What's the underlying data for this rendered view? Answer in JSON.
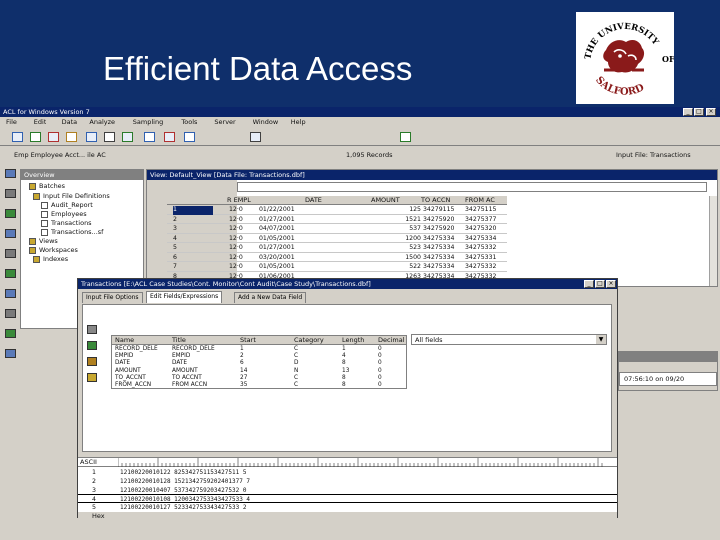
{
  "slide": {
    "title": "Efficient Data Access",
    "logo": {
      "top_text": "THE UNIVERSITY",
      "side_text": "OF",
      "bottom_text": "SALFORD",
      "emblem": "lion-crest-icon"
    }
  },
  "colors": {
    "header_band": "#0f2f6b",
    "title_bar": "#0a246a",
    "window_bg": "#d4d0c8",
    "logo_red": "#8a1a1a"
  },
  "app": {
    "title": "ACL for Windows Version 7",
    "menu": [
      "File",
      "Edit",
      "Data",
      "Analyze",
      "Sampling",
      "Tools",
      "Server",
      "Window",
      "Help"
    ],
    "status_left": "Emp Employee Acct... ile AC",
    "status_mid": "1,095 Records",
    "status_right": "Input File: Transactions",
    "time_display": "07:56:10 on 09/20",
    "toolbar_icons": [
      "open-icon",
      "save-icon",
      "print-icon",
      "cut-icon",
      "copy-icon",
      "paste-icon",
      "table-icon",
      "chart-icon",
      "filter-icon",
      "sort-icon",
      "find-icon",
      "help-icon"
    ]
  },
  "overview": {
    "title": "Overview",
    "items": [
      {
        "label": "Batches",
        "icon": "folder-icon"
      },
      {
        "label": "Input File Definitions",
        "icon": "folder-icon"
      },
      {
        "label": "Audit_Report",
        "icon": "file-icon"
      },
      {
        "label": "Employees",
        "icon": "file-icon"
      },
      {
        "label": "Transactions",
        "icon": "file-icon"
      },
      {
        "label": "Transactions...sf",
        "icon": "file-icon"
      },
      {
        "label": "Views",
        "icon": "folder-icon"
      },
      {
        "label": "Workspaces",
        "icon": "folder-icon"
      },
      {
        "label": "Indexes",
        "icon": "folder-icon"
      }
    ]
  },
  "view": {
    "title": "View: Default_View  [Data File: Transactions.dbf]",
    "columns": [
      "R EMPL",
      "DATE",
      "AMOUNT",
      "TO ACCN",
      "FROM AC"
    ],
    "rows": [
      {
        "n": "1",
        "empl": "12·0",
        "date": "01/22/2001",
        "amount": "125",
        "to": "34279115",
        "from": "34275115"
      },
      {
        "n": "2",
        "empl": "12·0",
        "date": "01/27/2001",
        "amount": "1521",
        "to": "34275920",
        "from": "34275377"
      },
      {
        "n": "3",
        "empl": "12·0",
        "date": "04/07/2001",
        "amount": "537",
        "to": "34275920",
        "from": "34275320"
      },
      {
        "n": "4",
        "empl": "12·0",
        "date": "01/05/2001",
        "amount": "1200",
        "to": "34275334",
        "from": "34275334"
      },
      {
        "n": "5",
        "empl": "12·0",
        "date": "01/27/2001",
        "amount": "523",
        "to": "34275334",
        "from": "34275332"
      },
      {
        "n": "6",
        "empl": "12·0",
        "date": "03/20/2001",
        "amount": "1500",
        "to": "34275334",
        "from": "34275331"
      },
      {
        "n": "7",
        "empl": "12·0",
        "date": "01/05/2001",
        "amount": "522",
        "to": "34275334",
        "from": "34275332"
      },
      {
        "n": "8",
        "empl": "12·0",
        "date": "01/06/2001",
        "amount": "1263",
        "to": "34275334",
        "from": "34275332"
      }
    ]
  },
  "transactions_window": {
    "title": "Transactions [E:\\ACL Case Studies\\Cont. Monitor\\Cont Audit\\Case Study\\Transactions.dbf]",
    "tabs": [
      "Input File Options",
      "Edit Fields/Expressions",
      "Add a New Data Field"
    ],
    "filter_value": "All fields",
    "headers": [
      "Name",
      "Title",
      "Start",
      "Category",
      "Length",
      "Decimal"
    ],
    "fields": [
      {
        "name": "RECORD_DELE",
        "title": "RECORD_DELE",
        "start": "1",
        "cat": "C",
        "len": "1",
        "dec": "0"
      },
      {
        "name": "EMPID",
        "title": "EMPID",
        "start": "2",
        "cat": "C",
        "len": "4",
        "dec": "0"
      },
      {
        "name": "DATE",
        "title": "DATE",
        "start": "6",
        "cat": "D",
        "len": "8",
        "dec": "0"
      },
      {
        "name": "AMOUNT",
        "title": "AMOUNT",
        "start": "14",
        "cat": "N",
        "len": "13",
        "dec": "0"
      },
      {
        "name": "TO_ACCNT",
        "title": "TO ACCNT",
        "start": "27",
        "cat": "C",
        "len": "8",
        "dec": "0"
      },
      {
        "name": "FROM_ACCN",
        "title": "FROM ACCN",
        "start": "35",
        "cat": "C",
        "len": "8",
        "dec": "0"
      }
    ],
    "raw_label": "ASCII",
    "raw_rows": [
      {
        "n": "1",
        "text": "12100220010122          825342751153427511 5"
      },
      {
        "n": "2",
        "text": "12100220010128          1521342759202401377 7"
      },
      {
        "n": "3",
        "text": "12100220010407           537342759203427532 0"
      },
      {
        "n": "4",
        "text": "12100220010108          1200342753343427533 4"
      },
      {
        "n": "5",
        "text": "12100220010127           523342753343427533 2"
      }
    ],
    "hex_label": "Hex"
  }
}
